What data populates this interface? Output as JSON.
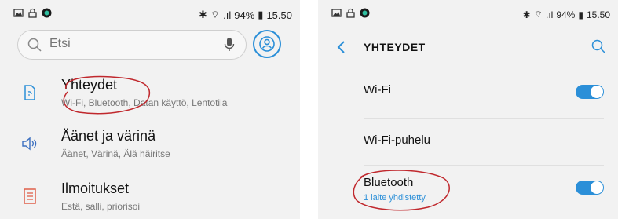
{
  "left": {
    "status": {
      "battery": "94%",
      "time": "15.50"
    },
    "search": {
      "placeholder": "Etsi"
    },
    "items": [
      {
        "title": "Yhteydet",
        "subtitle": "Wi-Fi, Bluetooth, Datan käyttö, Lentotila",
        "icon": "connections-icon"
      },
      {
        "title": "Äänet ja värinä",
        "subtitle": "Äänet, Värinä, Älä häiritse",
        "icon": "sound-icon"
      },
      {
        "title": "Ilmoitukset",
        "subtitle": "Estä, salli, priorisoi",
        "icon": "notifications-icon"
      }
    ]
  },
  "right": {
    "status": {
      "battery": "94%",
      "time": "15.50"
    },
    "header": {
      "title": "YHTEYDET"
    },
    "items": [
      {
        "title": "Wi-Fi",
        "subtitle": "",
        "toggle": "on"
      },
      {
        "title": "Wi-Fi-puhelu",
        "subtitle": ""
      },
      {
        "title": "Bluetooth",
        "subtitle": "1 laite yhdistetty.",
        "toggle": "on"
      }
    ]
  },
  "colors": {
    "accent": "#2b8fd8",
    "annotation": "#c0282d"
  }
}
